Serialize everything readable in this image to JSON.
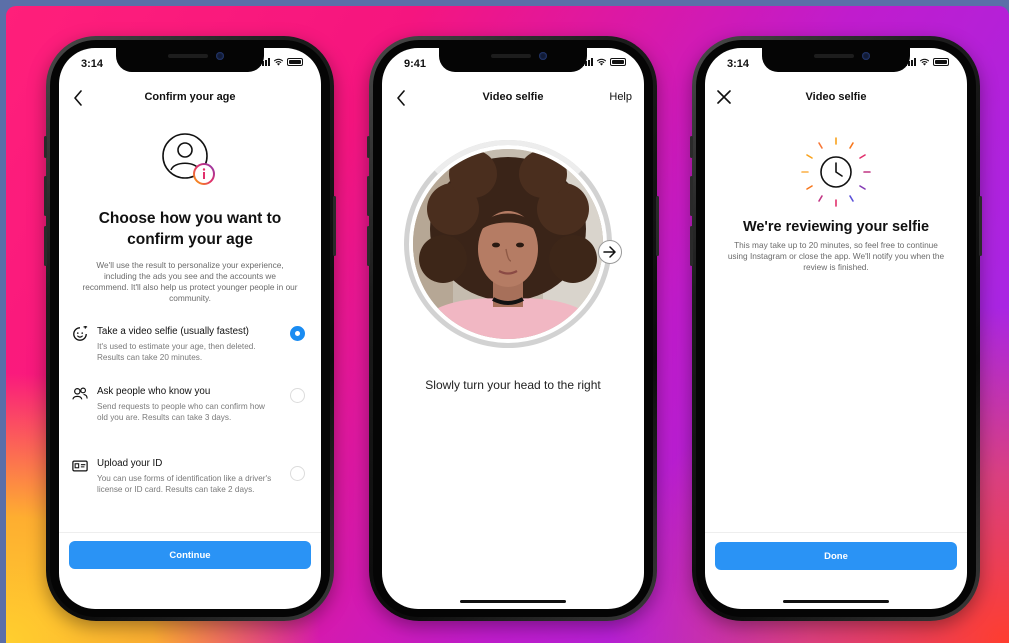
{
  "colors": {
    "primary_button": "#2a93f5",
    "radio_selected": "#1a8cf2",
    "text_primary": "#111111",
    "text_secondary": "#6b6b6b",
    "badge_gradient": [
      "#ffb000",
      "#e1306c",
      "#833ab4"
    ]
  },
  "phones": [
    {
      "status_time": "3:14",
      "nav": {
        "back_icon": "chevron-left-icon",
        "title": "Confirm your age"
      },
      "header_icon": "user-circle-info-icon",
      "headline": "Choose how you want to confirm your age",
      "description": "We'll use the result to personalize your experience, including the ads you see and the accounts we recommend. It'll also help us protect younger people in our community.",
      "options": [
        {
          "icon": "selfie-face-icon",
          "title": "Take a video selfie (usually fastest)",
          "description": "It's used to estimate your age, then deleted. Results can take 20 minutes.",
          "selected": true
        },
        {
          "icon": "people-icon",
          "title": "Ask people who know you",
          "description": "Send requests to people who can confirm how old you are. Results can take 3 days.",
          "selected": false
        },
        {
          "icon": "id-card-icon",
          "title": "Upload your ID",
          "description": "You can use forms of identification like a driver's license or ID card. Results can take 2 days.",
          "selected": false
        }
      ],
      "button_label": "Continue"
    },
    {
      "status_time": "9:41",
      "nav": {
        "back_icon": "chevron-left-icon",
        "title": "Video selfie",
        "help_label": "Help"
      },
      "arrow_icon": "arrow-right-icon",
      "instruction": "Slowly turn your head to the right"
    },
    {
      "status_time": "3:14",
      "nav": {
        "close_icon": "close-icon",
        "title": "Video selfie"
      },
      "status_icon": "clock-icon",
      "headline": "We're reviewing your selfie",
      "description": "This may take up to 20 minutes, so feel free to continue using Instagram or close the app. We'll notify you when the review is finished.",
      "button_label": "Done"
    }
  ]
}
